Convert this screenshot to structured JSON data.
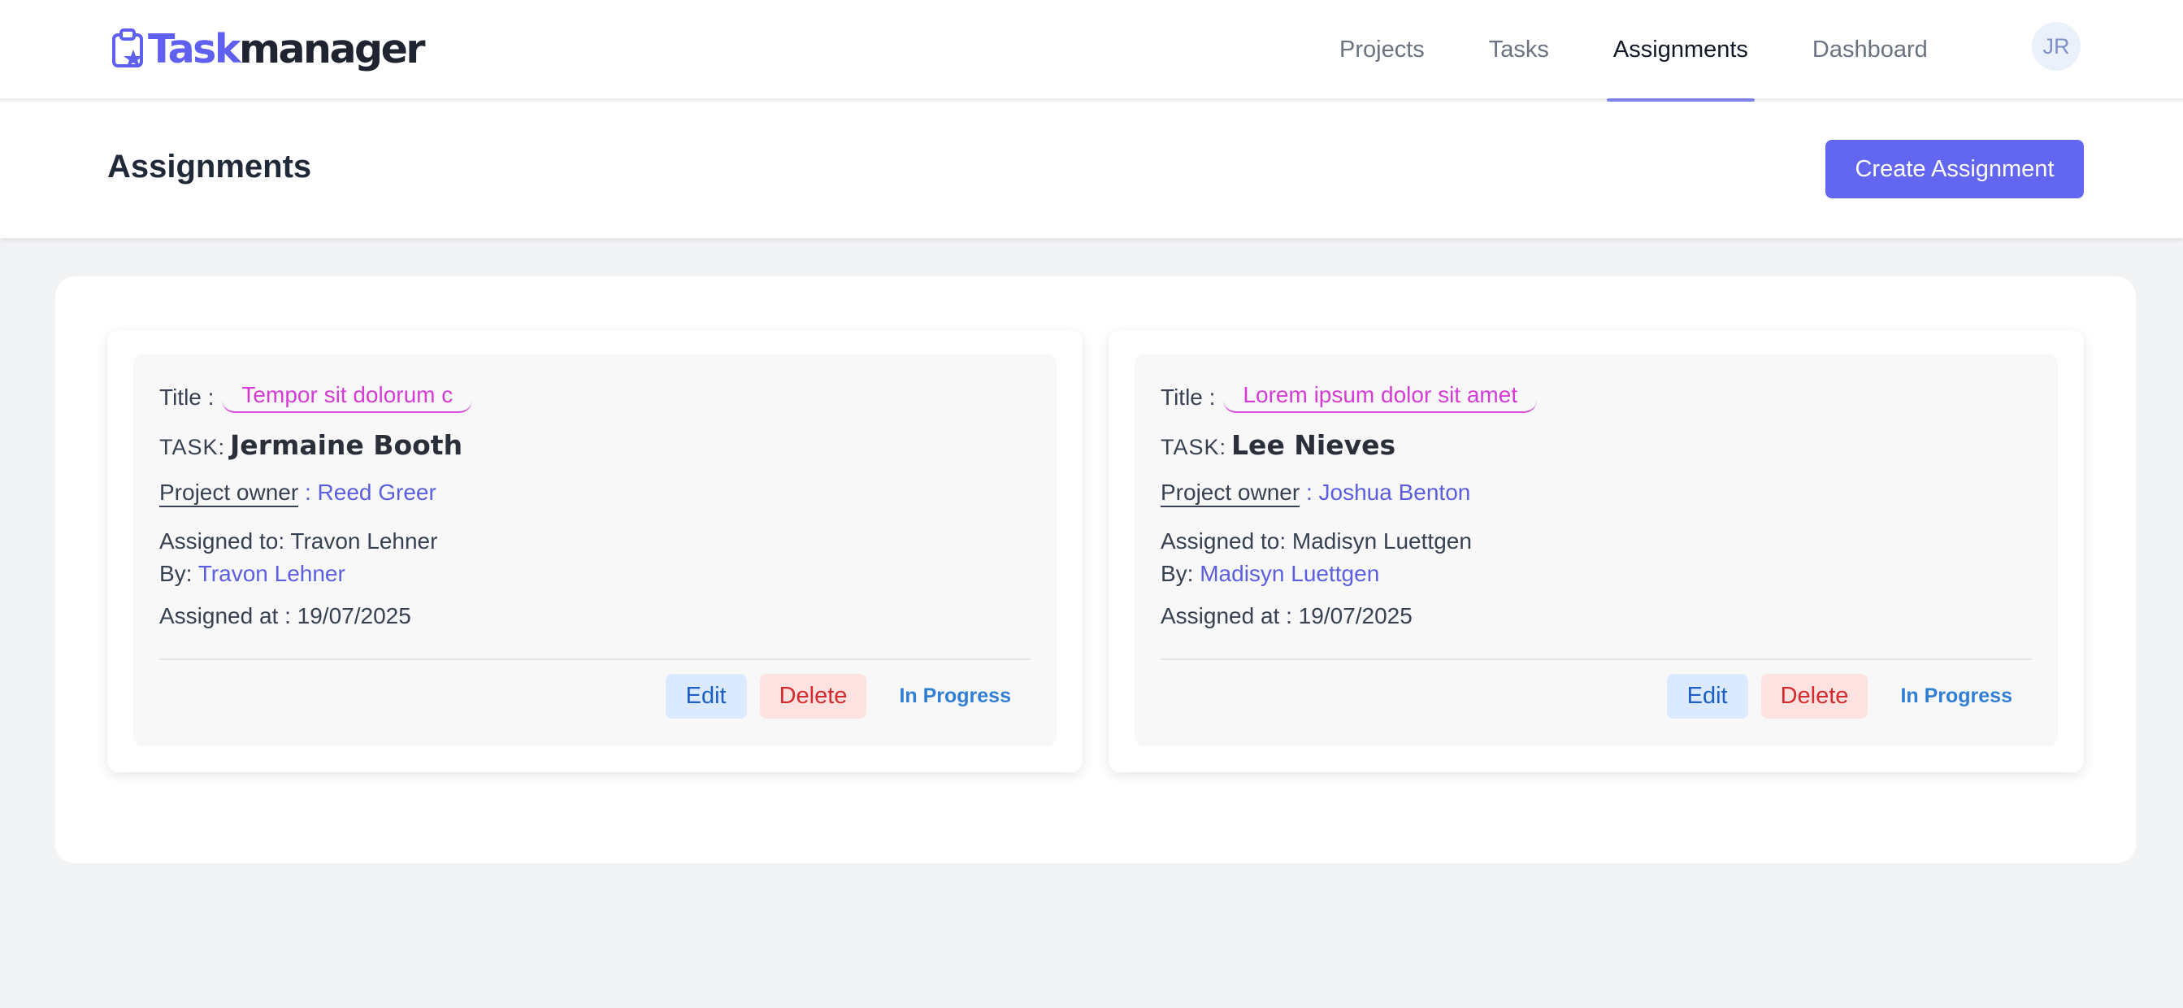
{
  "app": {
    "logo_accent": "Task",
    "logo_rest": "manager",
    "brand_color": "#6366f1"
  },
  "nav": {
    "items": [
      {
        "label": "Projects",
        "active": false
      },
      {
        "label": "Tasks",
        "active": false
      },
      {
        "label": "Assignments",
        "active": true
      },
      {
        "label": "Dashboard",
        "active": false
      }
    ],
    "avatar_initials": "JR"
  },
  "header": {
    "title": "Assignments",
    "create_button": "Create Assignment"
  },
  "labels": {
    "title": "Title :",
    "task": "TASK:",
    "project_owner": "Project owner",
    "owner_sep": " : ",
    "assigned_to": "Assigned to: ",
    "by": "By: ",
    "assigned_at": "Assigned at : ",
    "edit": "Edit",
    "delete": "Delete"
  },
  "assignments": [
    {
      "title": "Tempor sit dolorum c",
      "task": "Jermaine Booth",
      "project_owner": "Reed Greer",
      "assigned_to": "Travon Lehner",
      "by": "Travon Lehner",
      "assigned_at": "19/07/2025",
      "status": "In Progress"
    },
    {
      "title": "Lorem ipsum dolor sit amet",
      "task": "Lee Nieves",
      "project_owner": "Joshua Benton",
      "assigned_to": "Madisyn Luettgen",
      "by": "Madisyn Luettgen",
      "assigned_at": "19/07/2025",
      "status": "In Progress"
    }
  ]
}
